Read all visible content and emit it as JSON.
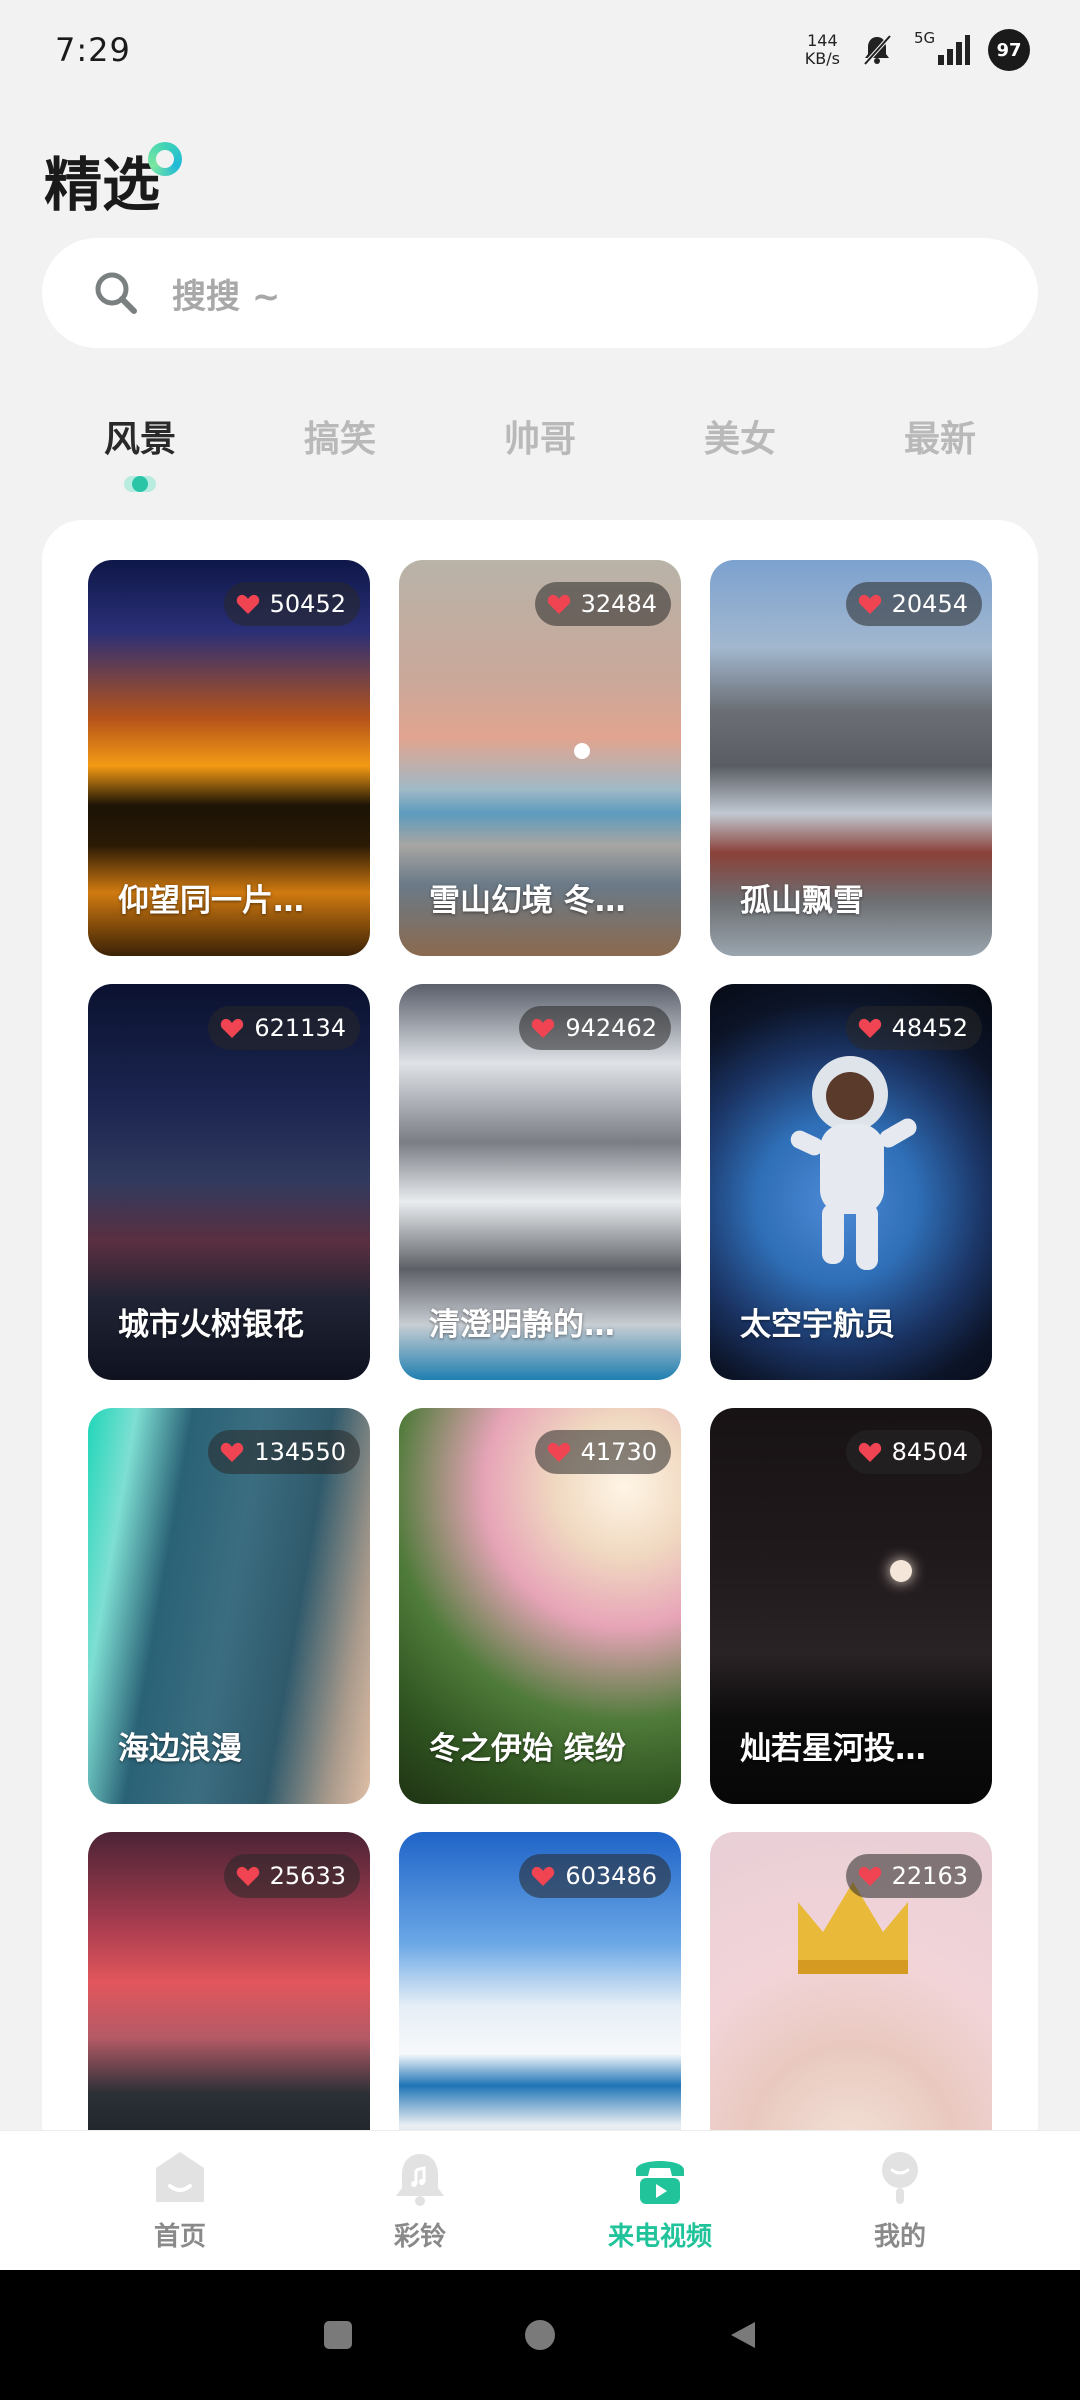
{
  "status_bar": {
    "time": "7:29",
    "net_speed_value": "144",
    "net_speed_unit": "KB/s",
    "signal_label": "5G",
    "battery": "97"
  },
  "header": {
    "title": "精选"
  },
  "search": {
    "placeholder": "搜搜 ~"
  },
  "tabs": [
    {
      "label": "风景",
      "active": true
    },
    {
      "label": "搞笑",
      "active": false
    },
    {
      "label": "帅哥",
      "active": false
    },
    {
      "label": "美女",
      "active": false
    },
    {
      "label": "最新",
      "active": false
    }
  ],
  "cards": [
    {
      "likes": "50452",
      "title": "仰望同一片…"
    },
    {
      "likes": "32484",
      "title": "雪山幻境 冬…"
    },
    {
      "likes": "20454",
      "title": "孤山飘雪"
    },
    {
      "likes": "621134",
      "title": "城市火树银花"
    },
    {
      "likes": "942462",
      "title": "清澄明静的…"
    },
    {
      "likes": "48452",
      "title": "太空宇航员"
    },
    {
      "likes": "134550",
      "title": "海边浪漫"
    },
    {
      "likes": "41730",
      "title": "冬之伊始 缤纷"
    },
    {
      "likes": "84504",
      "title": "灿若星河投…"
    },
    {
      "likes": "25633",
      "title": ""
    },
    {
      "likes": "603486",
      "title": ""
    },
    {
      "likes": "22163",
      "title": ""
    }
  ],
  "bottom_nav": [
    {
      "label": "首页",
      "icon": "home-icon",
      "active": false
    },
    {
      "label": "彩铃",
      "icon": "ringtone-bell-icon",
      "active": false
    },
    {
      "label": "来电视频",
      "icon": "call-video-phone-icon",
      "active": true
    },
    {
      "label": "我的",
      "icon": "profile-icon",
      "active": false
    }
  ],
  "colors": {
    "accent": "#21c49a",
    "background": "#f2f2f2"
  }
}
